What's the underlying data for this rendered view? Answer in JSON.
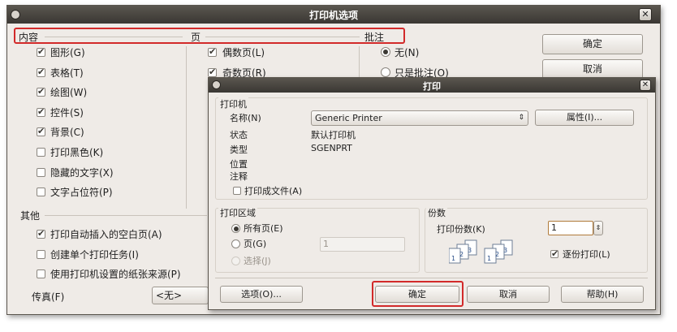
{
  "main": {
    "title": "打印机选项",
    "header": {
      "content": "内容",
      "pages": "页",
      "notes": "批注"
    },
    "content_items": [
      {
        "label": "图形(G)",
        "checked": true
      },
      {
        "label": "表格(T)",
        "checked": true
      },
      {
        "label": "绘图(W)",
        "checked": true
      },
      {
        "label": "控件(S)",
        "checked": true
      },
      {
        "label": "背景(C)",
        "checked": true
      },
      {
        "label": "打印黑色(K)",
        "checked": false
      },
      {
        "label": "隐藏的文字(X)",
        "checked": false
      },
      {
        "label": "文字占位符(P)",
        "checked": false
      }
    ],
    "page_items": [
      {
        "label": "偶数页(L)",
        "checked": true
      },
      {
        "label": "奇数页(R)",
        "checked": true
      }
    ],
    "notes_items": [
      {
        "label": "无(N)",
        "selected": true
      },
      {
        "label": "只是批注(O)",
        "selected": false
      }
    ],
    "other": {
      "heading": "其他",
      "items": [
        {
          "label": "打印自动插入的空白页(A)",
          "checked": true
        },
        {
          "label": "创建单个打印任务(I)",
          "checked": false
        },
        {
          "label": "使用打印机设置的纸张来源(P)",
          "checked": false
        }
      ]
    },
    "fax": {
      "label": "传真(F)",
      "value": "<无>"
    },
    "ok": "确定",
    "cancel": "取消"
  },
  "print": {
    "title": "打印",
    "printer_section": "打印机",
    "name_label": "名称(N)",
    "printer_name": "Generic Printer",
    "properties": "属性(I)...",
    "status_label": "状态",
    "status_value": "默认打印机",
    "type_label": "类型",
    "type_value": "SGENPRT",
    "location_label": "位置",
    "comment_label": "注释",
    "print_to_file": "打印成文件(A)",
    "range_section": "打印区域",
    "all_pages": "所有页(E)",
    "pages": "页(G)",
    "pages_value": "1",
    "selection": "选择(J)",
    "copies_section": "份数",
    "copies_label": "打印份数(K)",
    "copies_value": "1",
    "collate": "逐份打印(L)",
    "options": "选项(O)...",
    "ok": "确定",
    "cancel": "取消",
    "help": "帮助(H)"
  },
  "colors": {
    "highlight": "#d22a2a",
    "titlebar": "#3f3c37",
    "dialog_bg": "#efebe7"
  },
  "icons": {
    "close": "close-icon",
    "menu": "window-menu-icon",
    "collate": "collate-pages-icon"
  }
}
